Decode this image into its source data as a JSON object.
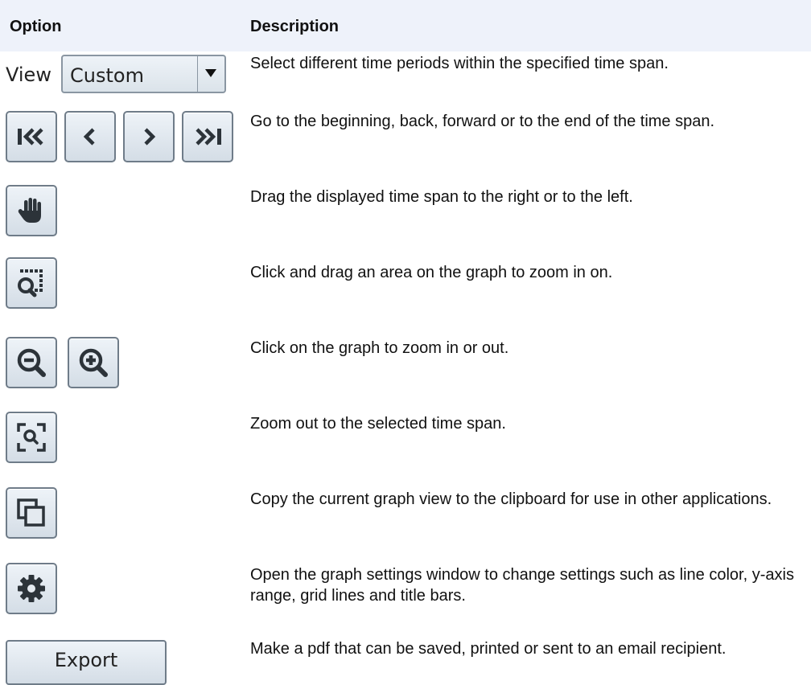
{
  "header": {
    "option": "Option",
    "description": "Description"
  },
  "view_control": {
    "label": "View",
    "selected": "Custom"
  },
  "rows": [
    {
      "description": "Select different time periods within the specified time span."
    },
    {
      "description": "Go to the beginning, back, forward or to the end of the time span."
    },
    {
      "description": "Drag the displayed time span to the right or to the left."
    },
    {
      "description": "Click and drag an area on the graph to zoom in on."
    },
    {
      "description": "Click on the graph to zoom in or out."
    },
    {
      "description": "Zoom out to the selected time span."
    },
    {
      "description": "Copy the current graph view to the clipboard for use in other applications."
    },
    {
      "description": "Open the graph settings window to change settings such as line color, y-axis range, grid lines and title bars."
    },
    {
      "description": "Make a pdf that can be saved, printed or sent to an email recipient."
    }
  ],
  "export_button": {
    "label": "Export"
  },
  "icons": {
    "nav": [
      "skip-to-start-icon",
      "step-back-icon",
      "step-forward-icon",
      "skip-to-end-icon"
    ],
    "pan": "hand-icon",
    "zoom_area": "zoom-area-icon",
    "zoom": [
      "zoom-out-icon",
      "zoom-in-icon"
    ],
    "zoom_fit": "zoom-fit-icon",
    "copy": "copy-icon",
    "settings": "gear-icon"
  },
  "colors": {
    "header_bg": "#eef2fa",
    "icon": "#2c3339",
    "button_border": "#6f7c89"
  }
}
